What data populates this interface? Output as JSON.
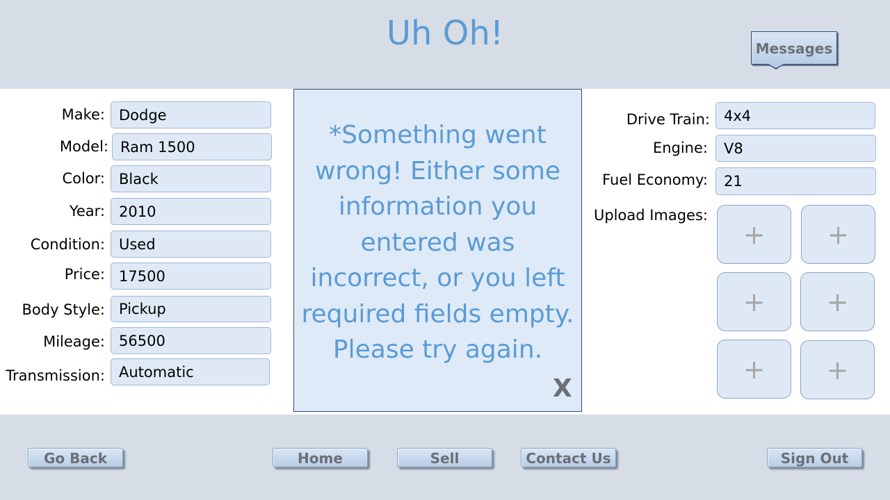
{
  "header": {
    "title": "Uh Oh!",
    "messages_label": "Messages"
  },
  "vehicle": {
    "make": {
      "label": "Make:",
      "value": "Dodge"
    },
    "model": {
      "label": "Model:",
      "value": "Ram 1500"
    },
    "color": {
      "label": "Color:",
      "value": "Black"
    },
    "year": {
      "label": "Year:",
      "value": "2010"
    },
    "condition": {
      "label": "Condition:",
      "value": "Used"
    },
    "price": {
      "label": "Price:",
      "value": "17500"
    },
    "body_style": {
      "label": "Body Style:",
      "value": "Pickup"
    },
    "mileage": {
      "label": "Mileage:",
      "value": "56500"
    },
    "transmission": {
      "label": "Transmission:",
      "value": "Automatic"
    },
    "drive_train": {
      "label": "Drive Train:",
      "value": "4x4"
    },
    "engine": {
      "label": "Engine:",
      "value": "V8"
    },
    "fuel_economy": {
      "label": "Fuel Economy:",
      "value": "21"
    }
  },
  "upload": {
    "label": "Upload Images:",
    "slot_glyph": "+"
  },
  "error_dialog": {
    "message": "*Something went wrong! Either some information you entered was incorrect, or you left required fields empty. Please try again.",
    "close_label": "X"
  },
  "footer": {
    "go_back": "Go Back",
    "home": "Home",
    "sell": "Sell",
    "contact_us": "Contact Us",
    "sign_out": "Sign Out"
  },
  "colors": {
    "accent": "#5b9bd5",
    "header_bg": "#d6dde6",
    "field_bg": "#dfe9f6",
    "dialog_border": "#2f4f7a"
  }
}
